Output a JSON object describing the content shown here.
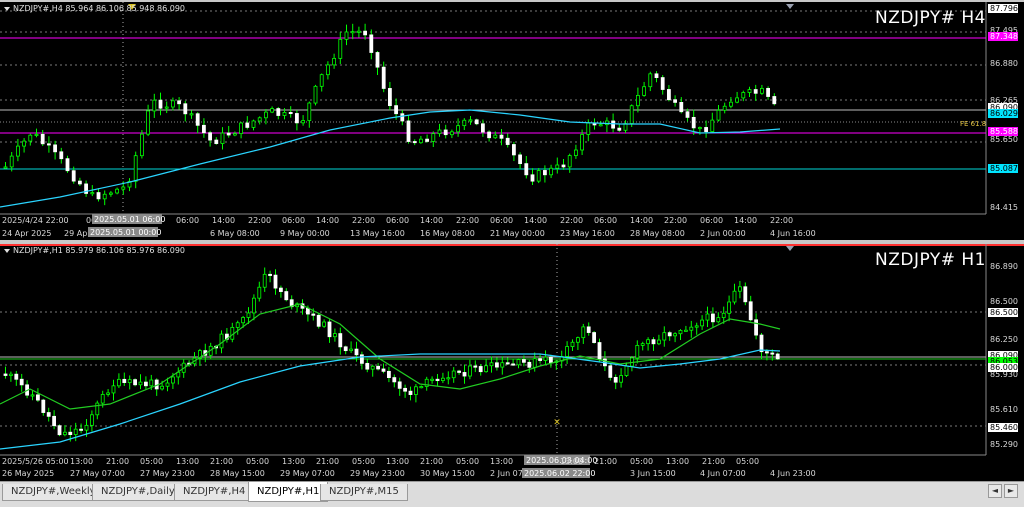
{
  "charts": [
    {
      "id": "h4",
      "header": "NZDJPY#,H4  85.964 86.106 85.948 86.090",
      "title": "NZDJPY#  H4",
      "price_labels": [
        "87.796",
        "87.495",
        "86.880",
        "86.265",
        "85.650",
        "84.415"
      ],
      "price_boxes": [
        {
          "text": "87.796",
          "bg": "#ffffff",
          "fg": "#000000"
        },
        {
          "text": "87.348",
          "bg": "#ff00ff",
          "fg": "#ffffff"
        },
        {
          "text": "86.090",
          "bg": "#ffffff",
          "fg": "#000000"
        },
        {
          "text": "86.029",
          "bg": "#00e5ff",
          "fg": "#000000"
        },
        {
          "text": "85.588",
          "bg": "#ff00ff",
          "fg": "#ffffff"
        },
        {
          "text": "85.087",
          "bg": "#00e5ff",
          "fg": "#000000"
        }
      ],
      "fe_label": "FE 61.8",
      "time_labels_top": [
        "2025/4/24 22:00",
        "06:00",
        "2025.05.01 06:00",
        "06:00",
        "14:00",
        "22:00",
        "06:00",
        "14:00",
        "22:00",
        "06:00",
        "14:00",
        "22:00",
        "06:00",
        "14:00",
        "22:00",
        "06:00",
        "14:00",
        "22:00",
        "06:00",
        "14:00",
        "22:00"
      ],
      "time_labels_bottom": [
        "24 Apr 2025",
        "29 Apr 16:00",
        "2025.05.01 00:00",
        "6 May 08:00",
        "9 May 00:00",
        "13 May 16:00",
        "16 May 08:00",
        "21 May 00:00",
        "23 May 16:00",
        "28 May 08:00",
        "2 Jun 00:00",
        "4 Jun 16:00"
      ],
      "colors": {
        "ma": "#2ad4ff",
        "level": "#ff00ff",
        "grid": "#7a7a7a"
      }
    },
    {
      "id": "h1",
      "header": "NZDJPY#,H1  85.979 86.106 85.976 86.090",
      "title": "NZDJPY#  H1",
      "price_labels": [
        "86.890",
        "86.500",
        "86.250",
        "85.930",
        "85.610",
        "85.290"
      ],
      "price_boxes": [
        {
          "text": "86.500",
          "bg": "#ffffff",
          "fg": "#000000"
        },
        {
          "text": "86.090",
          "bg": "#ffffff",
          "fg": "#000000"
        },
        {
          "text": "86.053",
          "bg": "#00ff00",
          "fg": "#000000"
        },
        {
          "text": "86.000",
          "bg": "#ffffff",
          "fg": "#000000"
        },
        {
          "text": "85.460",
          "bg": "#ffffff",
          "fg": "#000000"
        }
      ],
      "time_labels_top": [
        "2025/5/26 05:00",
        "13:00",
        "21:00",
        "05:00",
        "13:00",
        "21:00",
        "05:00",
        "13:00",
        "21:00",
        "05:00",
        "13:00",
        "21:00",
        "05:00",
        "13:00",
        "2025.06.03 04:00",
        "13:00",
        "21:00",
        "05:00",
        "13:00",
        "21:00",
        "05:00"
      ],
      "time_labels_bottom": [
        "26 May 2025",
        "27 May 07:00",
        "27 May 23:00",
        "28 May 15:00",
        "29 May 07:00",
        "29 May 23:00",
        "30 May 15:00",
        "2 Jun 07:00",
        "2025.06.02 22:00",
        "3 Jun 15:00",
        "4 Jun 07:00",
        "4 Jun 23:00"
      ],
      "colors": {
        "ma_fast": "#22cc22",
        "ma_slow": "#2ad4ff",
        "top_line": "#ff3030",
        "grid": "#7a7a7a"
      }
    }
  ],
  "tabs": [
    {
      "label": "NZDJPY#,Weekly",
      "active": false
    },
    {
      "label": "NZDJPY#,Daily",
      "active": false
    },
    {
      "label": "NZDJPY#,H4",
      "active": false
    },
    {
      "label": "NZDJPY#,H1",
      "active": true
    },
    {
      "label": "NZDJPY#,M15",
      "active": false
    }
  ],
  "nav": {
    "left": "◄",
    "right": "►"
  }
}
